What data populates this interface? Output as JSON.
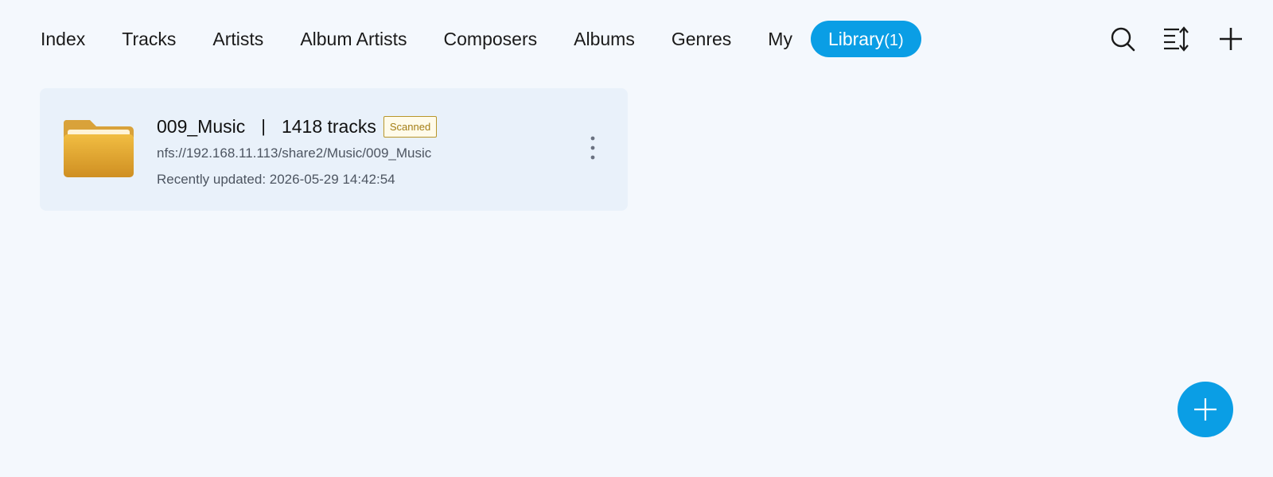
{
  "nav": {
    "tabs": [
      {
        "label": "Index"
      },
      {
        "label": "Tracks"
      },
      {
        "label": "Artists"
      },
      {
        "label": "Album Artists"
      },
      {
        "label": "Composers"
      },
      {
        "label": "Albums"
      },
      {
        "label": "Genres"
      },
      {
        "label": "My"
      }
    ],
    "active_tab": {
      "label": "Library",
      "count": "(1)"
    }
  },
  "toolbar": {
    "icons": [
      "search-icon",
      "sort-icon",
      "plus-icon"
    ]
  },
  "library": {
    "items": [
      {
        "name": "009_Music",
        "separator": "|",
        "tracks": "1418 tracks",
        "badge": "Scanned",
        "path": "nfs://192.168.11.113/share2/Music/009_Music",
        "updated": "Recently updated: 2026-05-29 14:42:54",
        "icon": "folder-icon"
      }
    ]
  },
  "fab": {
    "icon": "plus-icon"
  },
  "colors": {
    "accent": "#0a9ee5",
    "background": "#f4f8fd",
    "card": "#e9f1fa",
    "badge_border": "#b8962a",
    "folder": "#e2a93a"
  }
}
